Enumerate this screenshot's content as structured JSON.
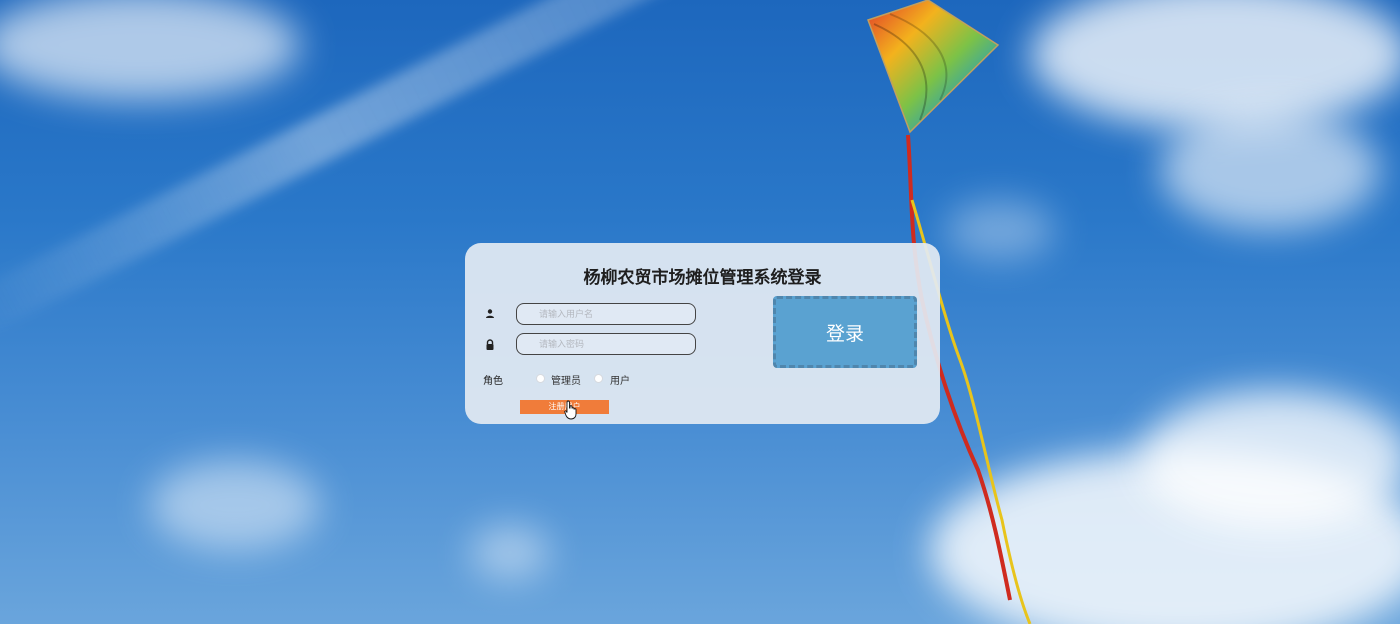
{
  "login": {
    "title": "杨柳农贸市场摊位管理系统登录",
    "username_placeholder": "请输入用户名",
    "password_placeholder": "请输入密码",
    "role_label": "角色",
    "roles": [
      {
        "label": "管理员",
        "selected": false
      },
      {
        "label": "用户",
        "selected": false
      }
    ],
    "register_button": "注册用户",
    "login_button": "登录"
  },
  "icons": {
    "username": "user-icon",
    "password": "lock-icon"
  },
  "colors": {
    "login_button": "#5aa2d1",
    "register_button": "#f07c3a",
    "sky": "#2a78c9"
  }
}
